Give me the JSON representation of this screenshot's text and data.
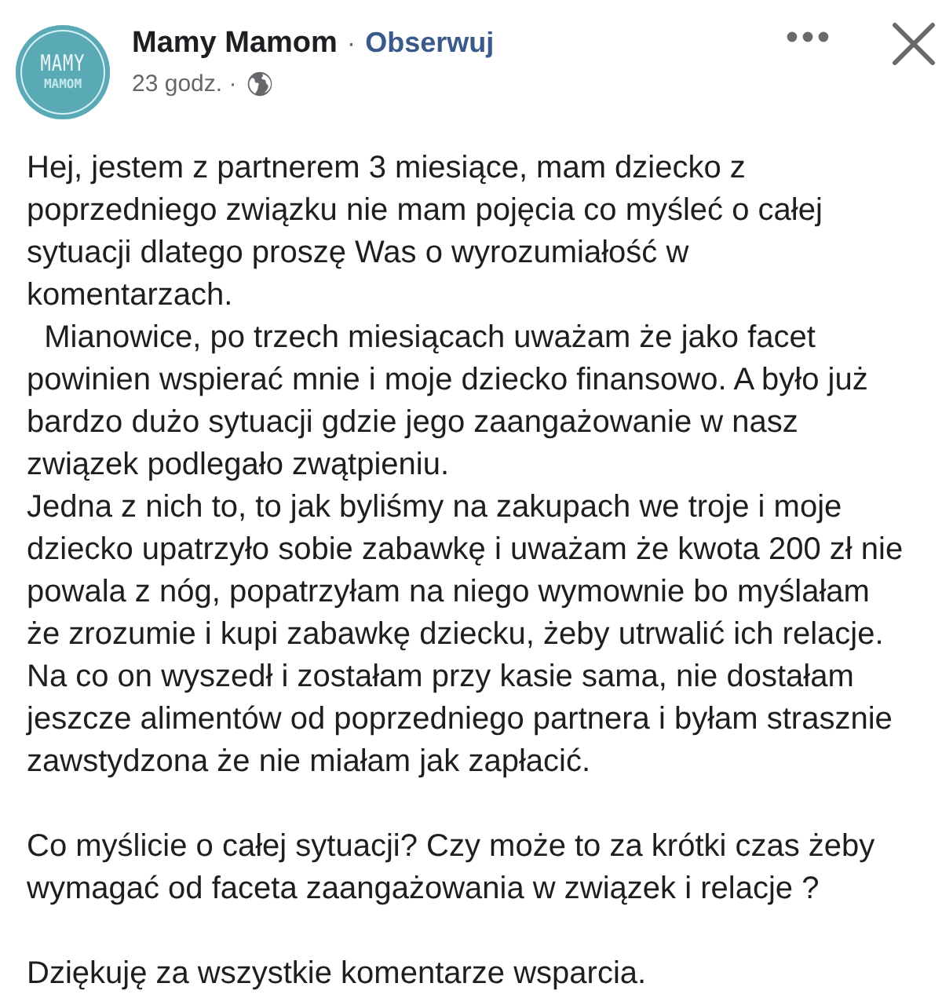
{
  "header": {
    "avatar": {
      "line_1": "MAMY",
      "line_2": "MAMOM"
    },
    "author": "Mamy Mamom",
    "separator": "·",
    "follow": "Obserwuj",
    "time": "23 godz. ·"
  },
  "body": {
    "sections": [
      {
        "paragraphs": [
          {
            "lines": [
              "Hej, jestem z partnerem 3 miesiące, mam dziecko z",
              "poprzedniego związku nie mam pojęcia co myśleć o całej",
              "sytuacji dlatego proszę Was o wyrozumiałość w",
              "komentarzach."
            ]
          },
          {
            "lines": [
              "  Mianowice, po trzech miesiącach uważam że jako facet",
              "powinien wspierać mnie i moje dziecko finansowo. A było już",
              "bardzo dużo sytuacji gdzie jego zaangażowanie w nasz",
              "związek podlegało zwątpieniu."
            ]
          },
          {
            "lines": [
              "Jedna z nich to, to jak byliśmy na zakupach we troje i moje",
              "dziecko upatrzyło sobie zabawkę i uważam że kwota 200 zł nie",
              "powala z nóg, popatrzyłam na niego wymownie bo myślałam",
              "że zrozumie i kupi zabawkę dziecku, żeby utrwalić ich relacje.",
              "Na co on wyszedł i zostałam przy kasie sama, nie dostałam",
              "jeszcze alimentów od poprzedniego partnera i byłam strasznie",
              "zawstydzona że nie miałam jak zapłacić."
            ]
          }
        ]
      },
      {
        "paragraphs": [
          {
            "lines": [
              "Co myślicie o całej sytuacji? Czy może to za krótki czas żeby",
              "wymagać od faceta zaangażowania w związek i relacje ?"
            ]
          }
        ]
      },
      {
        "paragraphs": [
          {
            "lines": [
              "Dziękuję za wszystkie komentarze wsparcia."
            ]
          }
        ]
      }
    ]
  }
}
